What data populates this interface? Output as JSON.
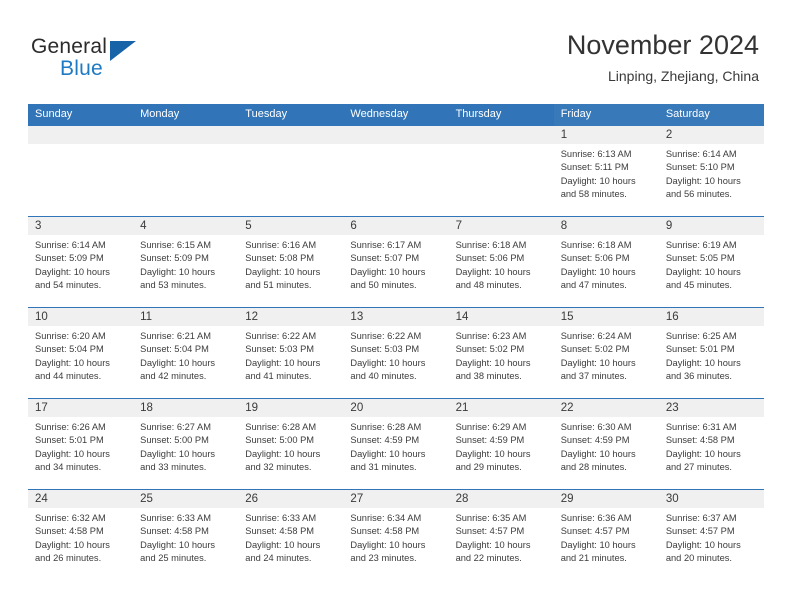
{
  "logo": {
    "word_one": "General",
    "word_two": "Blue",
    "triangle_icon": "triangle-icon",
    "triangle_color": "#1763a8",
    "blue_text_color": "#1f7ac4"
  },
  "header": {
    "title": "November 2024",
    "subtitle": "Linping, Zhejiang, China"
  },
  "theme": {
    "header_blue": "#3175b8",
    "header_blue_alt": "#3879b9",
    "daynum_band": "#f0f0f0",
    "text": "#3c3c3c"
  },
  "calendar": {
    "weekdays": [
      "Sunday",
      "Monday",
      "Tuesday",
      "Wednesday",
      "Thursday",
      "Friday",
      "Saturday"
    ],
    "labels": {
      "sunrise": "Sunrise:",
      "sunset": "Sunset:",
      "daylight": "Daylight:"
    },
    "weeks": [
      [
        {
          "day": "",
          "sunrise": "",
          "sunset": "",
          "daylight_line1": "",
          "daylight_line2": ""
        },
        {
          "day": "",
          "sunrise": "",
          "sunset": "",
          "daylight_line1": "",
          "daylight_line2": ""
        },
        {
          "day": "",
          "sunrise": "",
          "sunset": "",
          "daylight_line1": "",
          "daylight_line2": ""
        },
        {
          "day": "",
          "sunrise": "",
          "sunset": "",
          "daylight_line1": "",
          "daylight_line2": ""
        },
        {
          "day": "",
          "sunrise": "",
          "sunset": "",
          "daylight_line1": "",
          "daylight_line2": ""
        },
        {
          "day": "1",
          "sunrise": "Sunrise: 6:13 AM",
          "sunset": "Sunset: 5:11 PM",
          "daylight_line1": "Daylight: 10 hours",
          "daylight_line2": "and 58 minutes."
        },
        {
          "day": "2",
          "sunrise": "Sunrise: 6:14 AM",
          "sunset": "Sunset: 5:10 PM",
          "daylight_line1": "Daylight: 10 hours",
          "daylight_line2": "and 56 minutes."
        }
      ],
      [
        {
          "day": "3",
          "sunrise": "Sunrise: 6:14 AM",
          "sunset": "Sunset: 5:09 PM",
          "daylight_line1": "Daylight: 10 hours",
          "daylight_line2": "and 54 minutes."
        },
        {
          "day": "4",
          "sunrise": "Sunrise: 6:15 AM",
          "sunset": "Sunset: 5:09 PM",
          "daylight_line1": "Daylight: 10 hours",
          "daylight_line2": "and 53 minutes."
        },
        {
          "day": "5",
          "sunrise": "Sunrise: 6:16 AM",
          "sunset": "Sunset: 5:08 PM",
          "daylight_line1": "Daylight: 10 hours",
          "daylight_line2": "and 51 minutes."
        },
        {
          "day": "6",
          "sunrise": "Sunrise: 6:17 AM",
          "sunset": "Sunset: 5:07 PM",
          "daylight_line1": "Daylight: 10 hours",
          "daylight_line2": "and 50 minutes."
        },
        {
          "day": "7",
          "sunrise": "Sunrise: 6:18 AM",
          "sunset": "Sunset: 5:06 PM",
          "daylight_line1": "Daylight: 10 hours",
          "daylight_line2": "and 48 minutes."
        },
        {
          "day": "8",
          "sunrise": "Sunrise: 6:18 AM",
          "sunset": "Sunset: 5:06 PM",
          "daylight_line1": "Daylight: 10 hours",
          "daylight_line2": "and 47 minutes."
        },
        {
          "day": "9",
          "sunrise": "Sunrise: 6:19 AM",
          "sunset": "Sunset: 5:05 PM",
          "daylight_line1": "Daylight: 10 hours",
          "daylight_line2": "and 45 minutes."
        }
      ],
      [
        {
          "day": "10",
          "sunrise": "Sunrise: 6:20 AM",
          "sunset": "Sunset: 5:04 PM",
          "daylight_line1": "Daylight: 10 hours",
          "daylight_line2": "and 44 minutes."
        },
        {
          "day": "11",
          "sunrise": "Sunrise: 6:21 AM",
          "sunset": "Sunset: 5:04 PM",
          "daylight_line1": "Daylight: 10 hours",
          "daylight_line2": "and 42 minutes."
        },
        {
          "day": "12",
          "sunrise": "Sunrise: 6:22 AM",
          "sunset": "Sunset: 5:03 PM",
          "daylight_line1": "Daylight: 10 hours",
          "daylight_line2": "and 41 minutes."
        },
        {
          "day": "13",
          "sunrise": "Sunrise: 6:22 AM",
          "sunset": "Sunset: 5:03 PM",
          "daylight_line1": "Daylight: 10 hours",
          "daylight_line2": "and 40 minutes."
        },
        {
          "day": "14",
          "sunrise": "Sunrise: 6:23 AM",
          "sunset": "Sunset: 5:02 PM",
          "daylight_line1": "Daylight: 10 hours",
          "daylight_line2": "and 38 minutes."
        },
        {
          "day": "15",
          "sunrise": "Sunrise: 6:24 AM",
          "sunset": "Sunset: 5:02 PM",
          "daylight_line1": "Daylight: 10 hours",
          "daylight_line2": "and 37 minutes."
        },
        {
          "day": "16",
          "sunrise": "Sunrise: 6:25 AM",
          "sunset": "Sunset: 5:01 PM",
          "daylight_line1": "Daylight: 10 hours",
          "daylight_line2": "and 36 minutes."
        }
      ],
      [
        {
          "day": "17",
          "sunrise": "Sunrise: 6:26 AM",
          "sunset": "Sunset: 5:01 PM",
          "daylight_line1": "Daylight: 10 hours",
          "daylight_line2": "and 34 minutes."
        },
        {
          "day": "18",
          "sunrise": "Sunrise: 6:27 AM",
          "sunset": "Sunset: 5:00 PM",
          "daylight_line1": "Daylight: 10 hours",
          "daylight_line2": "and 33 minutes."
        },
        {
          "day": "19",
          "sunrise": "Sunrise: 6:28 AM",
          "sunset": "Sunset: 5:00 PM",
          "daylight_line1": "Daylight: 10 hours",
          "daylight_line2": "and 32 minutes."
        },
        {
          "day": "20",
          "sunrise": "Sunrise: 6:28 AM",
          "sunset": "Sunset: 4:59 PM",
          "daylight_line1": "Daylight: 10 hours",
          "daylight_line2": "and 31 minutes."
        },
        {
          "day": "21",
          "sunrise": "Sunrise: 6:29 AM",
          "sunset": "Sunset: 4:59 PM",
          "daylight_line1": "Daylight: 10 hours",
          "daylight_line2": "and 29 minutes."
        },
        {
          "day": "22",
          "sunrise": "Sunrise: 6:30 AM",
          "sunset": "Sunset: 4:59 PM",
          "daylight_line1": "Daylight: 10 hours",
          "daylight_line2": "and 28 minutes."
        },
        {
          "day": "23",
          "sunrise": "Sunrise: 6:31 AM",
          "sunset": "Sunset: 4:58 PM",
          "daylight_line1": "Daylight: 10 hours",
          "daylight_line2": "and 27 minutes."
        }
      ],
      [
        {
          "day": "24",
          "sunrise": "Sunrise: 6:32 AM",
          "sunset": "Sunset: 4:58 PM",
          "daylight_line1": "Daylight: 10 hours",
          "daylight_line2": "and 26 minutes."
        },
        {
          "day": "25",
          "sunrise": "Sunrise: 6:33 AM",
          "sunset": "Sunset: 4:58 PM",
          "daylight_line1": "Daylight: 10 hours",
          "daylight_line2": "and 25 minutes."
        },
        {
          "day": "26",
          "sunrise": "Sunrise: 6:33 AM",
          "sunset": "Sunset: 4:58 PM",
          "daylight_line1": "Daylight: 10 hours",
          "daylight_line2": "and 24 minutes."
        },
        {
          "day": "27",
          "sunrise": "Sunrise: 6:34 AM",
          "sunset": "Sunset: 4:58 PM",
          "daylight_line1": "Daylight: 10 hours",
          "daylight_line2": "and 23 minutes."
        },
        {
          "day": "28",
          "sunrise": "Sunrise: 6:35 AM",
          "sunset": "Sunset: 4:57 PM",
          "daylight_line1": "Daylight: 10 hours",
          "daylight_line2": "and 22 minutes."
        },
        {
          "day": "29",
          "sunrise": "Sunrise: 6:36 AM",
          "sunset": "Sunset: 4:57 PM",
          "daylight_line1": "Daylight: 10 hours",
          "daylight_line2": "and 21 minutes."
        },
        {
          "day": "30",
          "sunrise": "Sunrise: 6:37 AM",
          "sunset": "Sunset: 4:57 PM",
          "daylight_line1": "Daylight: 10 hours",
          "daylight_line2": "and 20 minutes."
        }
      ]
    ]
  }
}
